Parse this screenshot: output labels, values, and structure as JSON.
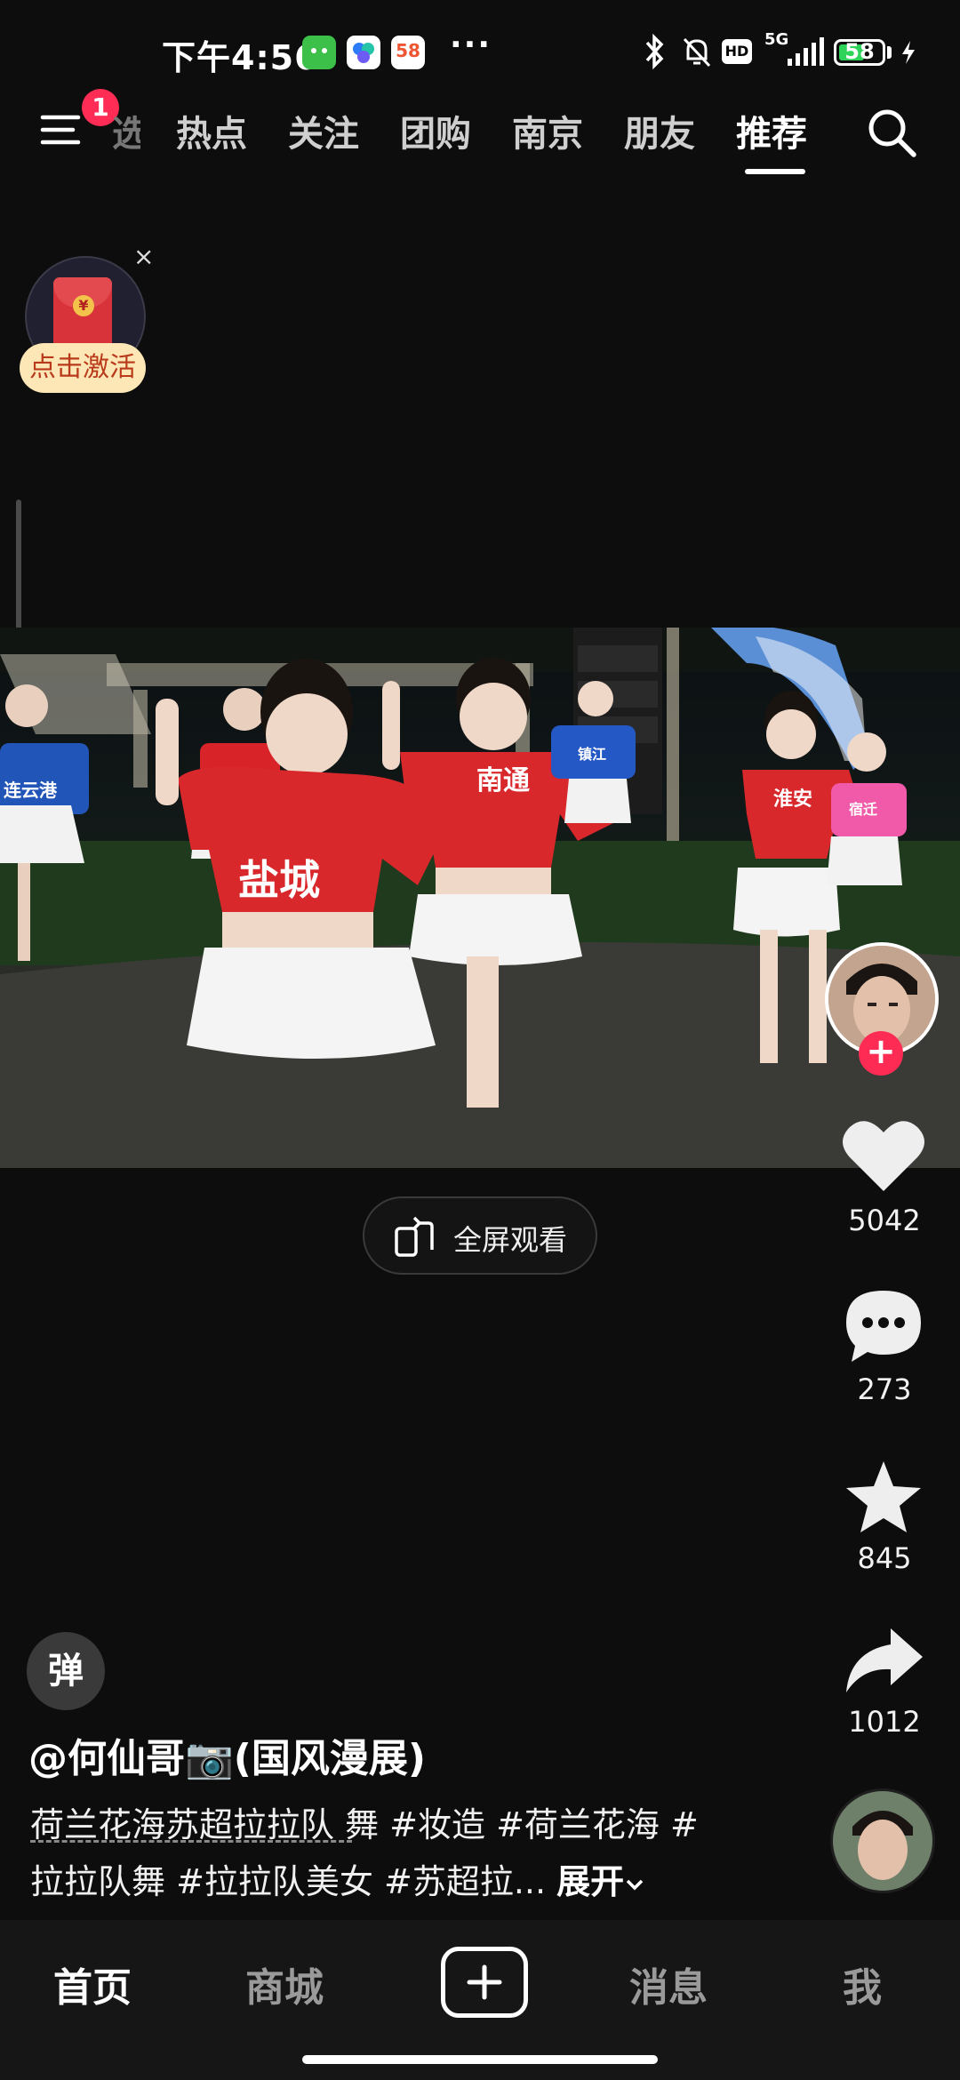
{
  "status_bar": {
    "time": "下午4:56",
    "app_icon_58": "58",
    "overflow": "···",
    "network": "5G",
    "hd": "HD",
    "battery": "58",
    "battery_level": 0.58
  },
  "top_nav": {
    "menu_badge": "1",
    "tabs": [
      {
        "label": "热点"
      },
      {
        "label": "关注"
      },
      {
        "label": "团购"
      },
      {
        "label": "南京"
      },
      {
        "label": "朋友"
      },
      {
        "label": "推荐"
      }
    ],
    "active_tab": "推荐"
  },
  "red_packet": {
    "label": "点击激活",
    "close": "×",
    "coin": "¥"
  },
  "video": {
    "jersey_texts": [
      "盐城",
      "南通",
      "淮安",
      "连云港",
      "镇江",
      "宿迁"
    ]
  },
  "fullscreen": {
    "label": "全屏观看"
  },
  "rail": {
    "likes": "5042",
    "comments": "273",
    "favorites": "845",
    "shares": "1012",
    "follow": "+"
  },
  "caption": {
    "danmaku": "弹",
    "author": "@何仙哥📷(国风漫展)",
    "line1": "荷兰花海苏超拉拉队 舞 #妆造 #荷兰花海 #",
    "line2_text": "拉拉队舞 #拉拉队美女 #苏超拉... ",
    "expand": "展开"
  },
  "bottom_nav": {
    "home": "首页",
    "mall": "商城",
    "messages": "消息",
    "me": "我"
  }
}
